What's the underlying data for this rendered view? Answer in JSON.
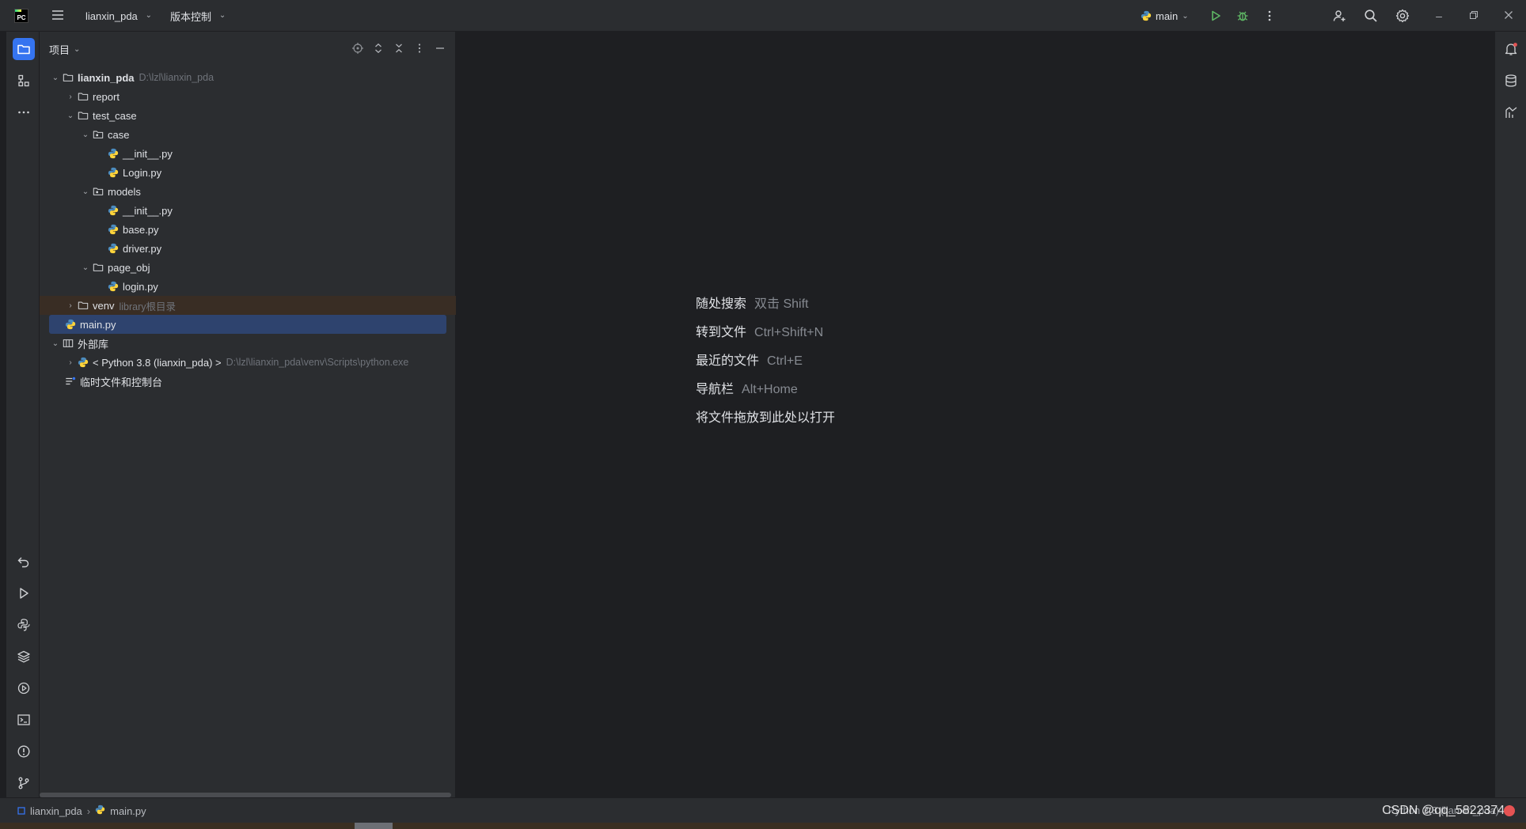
{
  "titlebar": {
    "project": "lianxin_pda",
    "vcs": "版本控制",
    "run_config": "main"
  },
  "project_panel": {
    "title": "项目",
    "tree": [
      {
        "label": "lianxin_pda",
        "path": "D:\\lzl\\lianxin_pda"
      },
      {
        "label": "report"
      },
      {
        "label": "test_case"
      },
      {
        "label": "case"
      },
      {
        "label": "__init__.py"
      },
      {
        "label": "Login.py"
      },
      {
        "label": "models"
      },
      {
        "label": "__init__.py"
      },
      {
        "label": "base.py"
      },
      {
        "label": "driver.py"
      },
      {
        "label": "page_obj"
      },
      {
        "label": "login.py"
      },
      {
        "label": "venv",
        "note": "library根目录"
      },
      {
        "label": "main.py"
      },
      {
        "label": "外部库"
      },
      {
        "label": "< Python 3.8 (lianxin_pda) >",
        "path": "D:\\lzl\\lianxin_pda\\venv\\Scripts\\python.exe"
      },
      {
        "label": "临时文件和控制台"
      }
    ]
  },
  "editor": {
    "hints": [
      {
        "action": "随处搜索",
        "shortcut": "双击 Shift"
      },
      {
        "action": "转到文件",
        "shortcut": "Ctrl+Shift+N"
      },
      {
        "action": "最近的文件",
        "shortcut": "Ctrl+E"
      },
      {
        "action": "导航栏",
        "shortcut": "Alt+Home"
      },
      {
        "action": "将文件拖放到此处以打开",
        "shortcut": ""
      }
    ]
  },
  "statusbar": {
    "crumb_project": "lianxin_pda",
    "crumb_file": "main.py",
    "interpreter": "Python 3.8 (lianxin_pda)"
  },
  "watermark": "CSDN @qq_58223744",
  "colors": {
    "accent": "#3574f0",
    "selection": "#2e436e",
    "excluded_row": "#392d24",
    "run_green": "#5fb865"
  }
}
